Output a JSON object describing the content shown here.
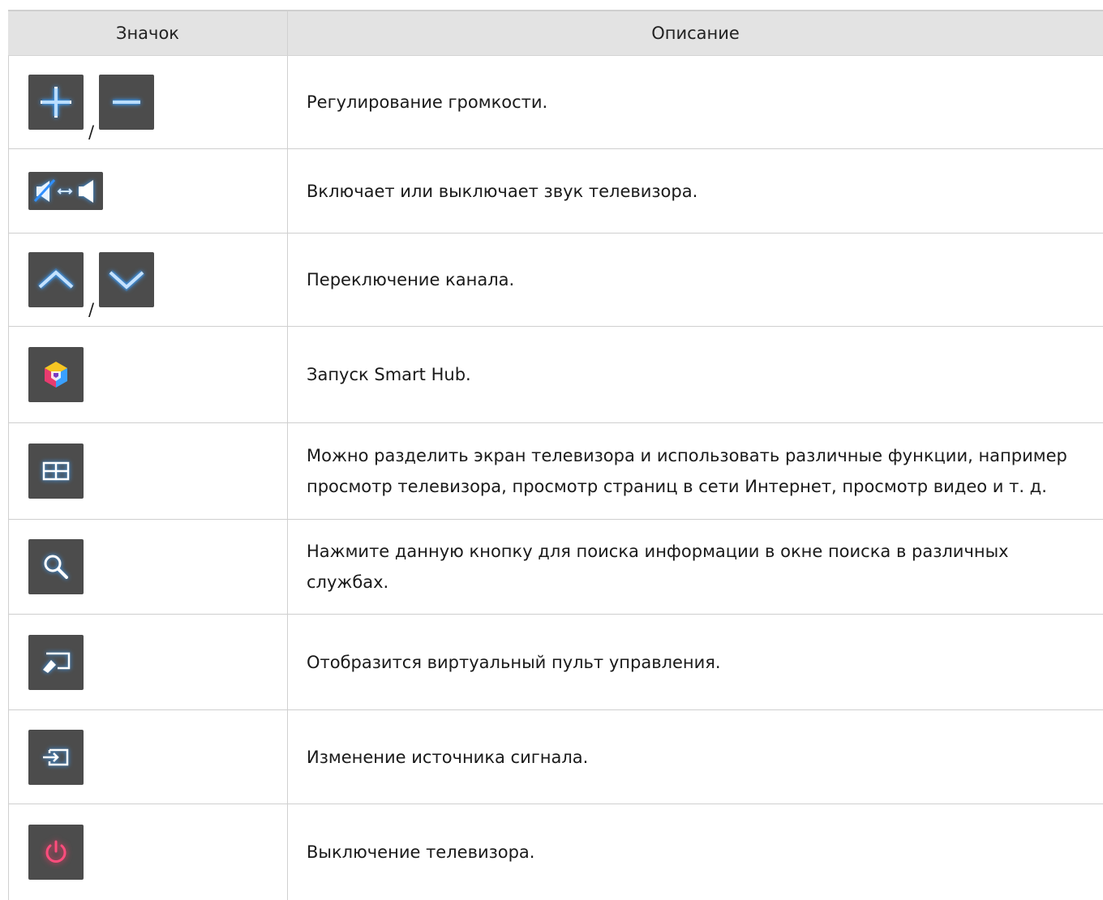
{
  "header": {
    "col_icon": "Значок",
    "col_description": "Описание"
  },
  "rows": [
    {
      "icons": [
        "plus-icon",
        "minus-icon"
      ],
      "separator": "/",
      "description": "Регулирование громкости."
    },
    {
      "icons": [
        "mute-toggle-icon"
      ],
      "description": "Включает или выключает звук телевизора."
    },
    {
      "icons": [
        "chevron-up-icon",
        "chevron-down-icon"
      ],
      "separator": "/",
      "description": "Переключение канала."
    },
    {
      "icons": [
        "smart-hub-icon"
      ],
      "description": "Запуск Smart Hub."
    },
    {
      "icons": [
        "multi-link-screen-icon"
      ],
      "description": "Можно разделить экран телевизора и использовать различные функции, например просмотр телевизора, просмотр страниц в сети Интернет, просмотр видео и т. д."
    },
    {
      "icons": [
        "search-icon"
      ],
      "description": "Нажмите данную кнопку для поиска информации в окне поиска в различных службах."
    },
    {
      "icons": [
        "virtual-remote-icon"
      ],
      "description": "Отобразится виртуальный пульт управления."
    },
    {
      "icons": [
        "source-icon"
      ],
      "description": "Изменение источника сигнала."
    },
    {
      "icons": [
        "power-icon"
      ],
      "description": "Выключение телевизора."
    }
  ],
  "colors": {
    "button_bg": "#4c4c4c",
    "icon_blue": "#2f8fff",
    "power_red": "#ff2f6e",
    "header_bg": "#e3e3e3"
  }
}
